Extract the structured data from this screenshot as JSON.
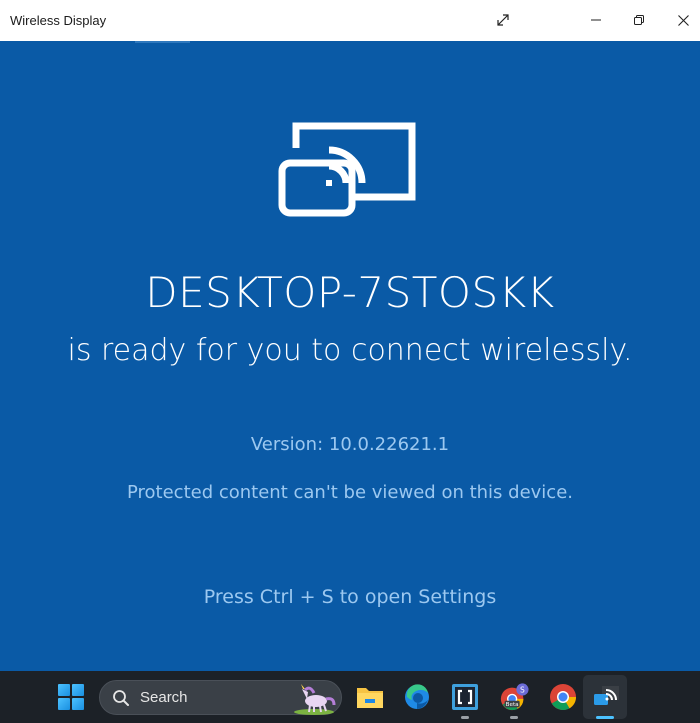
{
  "window": {
    "title": "Wireless Display",
    "controls": {
      "expand_icon": "expand-diagonal-icon",
      "minimize_icon": "minimize-icon",
      "restore_icon": "restore-icon",
      "close_icon": "close-icon"
    }
  },
  "main": {
    "hero_icon": "cast-to-device-icon",
    "device_name": "DESKTOP-7STOSKK",
    "ready_message": "is ready for you to connect wirelessly.",
    "version": "Version: 10.0.22621.1",
    "protected_notice": "Protected content can't be viewed on this device.",
    "settings_hint": "Press Ctrl + S to open Settings",
    "colors": {
      "background": "#0a5aa6",
      "primary_text": "#ffffff",
      "secondary_text": "#9cc8f0"
    }
  },
  "taskbar": {
    "start_icon": "windows-start-icon",
    "search": {
      "placeholder": "Search",
      "icon": "search-icon",
      "highlight_icon": "unicorn-icon"
    },
    "apps": [
      {
        "name": "File Explorer",
        "icon": "folder-icon",
        "running": false
      },
      {
        "name": "Microsoft Edge",
        "icon": "edge-icon",
        "running": false
      },
      {
        "name": "Brackets",
        "icon": "brackets-icon",
        "running": true
      },
      {
        "name": "Chrome Beta",
        "icon": "chrome-beta-icon",
        "running": true,
        "badge": "S",
        "label": "Beta"
      },
      {
        "name": "Google Chrome",
        "icon": "chrome-icon",
        "running": false
      },
      {
        "name": "Wireless Display",
        "icon": "wireless-display-icon",
        "running": true,
        "active": true
      }
    ]
  }
}
